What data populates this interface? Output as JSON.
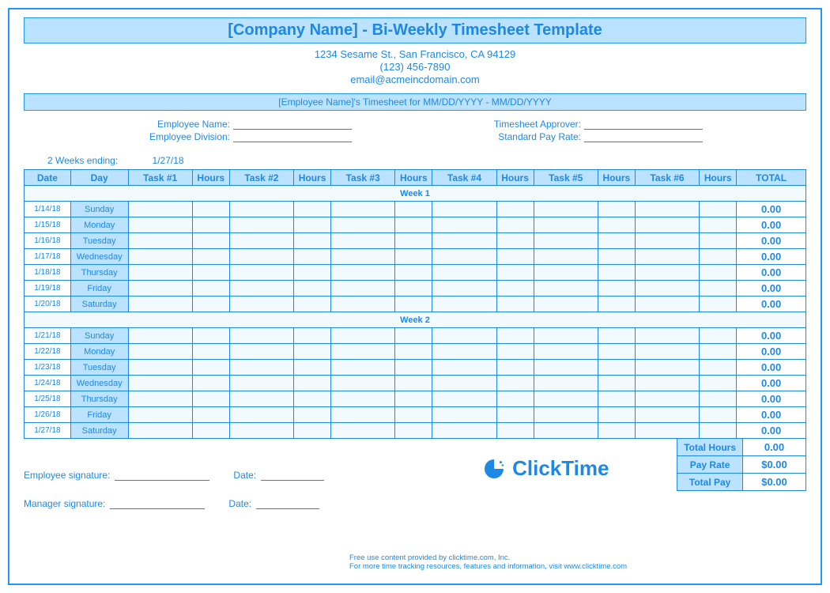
{
  "header": {
    "title": "[Company Name] - Bi-Weekly Timesheet Template",
    "address1": "1234 Sesame St., San Francisco, CA 94129",
    "phone": "(123) 456-7890",
    "email": "email@acmeincdomain.com"
  },
  "employee_bar": "[Employee Name]'s Timesheet for MM/DD/YYYY - MM/DD/YYYY",
  "info": {
    "name_label": "Employee Name:",
    "division_label": "Employee Division:",
    "approver_label": "Timesheet Approver:",
    "payrate_label": "Standard Pay Rate:"
  },
  "ending": {
    "label": "2 Weeks ending:",
    "value": "1/27/18"
  },
  "columns": {
    "date": "Date",
    "day": "Day",
    "t1": "Task #1",
    "h": "Hours",
    "t2": "Task #2",
    "t3": "Task #3",
    "t4": "Task #4",
    "t5": "Task #5",
    "t6": "Task #6",
    "total": "TOTAL"
  },
  "week1_label": "Week 1",
  "week2_label": "Week 2",
  "rows1": [
    {
      "date": "1/14/18",
      "day": "Sunday",
      "total": "0.00"
    },
    {
      "date": "1/15/18",
      "day": "Monday",
      "total": "0.00"
    },
    {
      "date": "1/16/18",
      "day": "Tuesday",
      "total": "0.00"
    },
    {
      "date": "1/17/18",
      "day": "Wednesday",
      "total": "0.00"
    },
    {
      "date": "1/18/18",
      "day": "Thursday",
      "total": "0.00"
    },
    {
      "date": "1/19/18",
      "day": "Friday",
      "total": "0.00"
    },
    {
      "date": "1/20/18",
      "day": "Saturday",
      "total": "0.00"
    }
  ],
  "rows2": [
    {
      "date": "1/21/18",
      "day": "Sunday",
      "total": "0.00"
    },
    {
      "date": "1/22/18",
      "day": "Monday",
      "total": "0.00"
    },
    {
      "date": "1/23/18",
      "day": "Tuesday",
      "total": "0.00"
    },
    {
      "date": "1/24/18",
      "day": "Wednesday",
      "total": "0.00"
    },
    {
      "date": "1/25/18",
      "day": "Thursday",
      "total": "0.00"
    },
    {
      "date": "1/26/18",
      "day": "Friday",
      "total": "0.00"
    },
    {
      "date": "1/27/18",
      "day": "Saturday",
      "total": "0.00"
    }
  ],
  "summary": {
    "total_hours_label": "Total Hours",
    "total_hours": "0.00",
    "pay_rate_label": "Pay Rate",
    "pay_rate": "$0.00",
    "total_pay_label": "Total Pay",
    "total_pay": "$0.00"
  },
  "signatures": {
    "emp": "Employee signature:",
    "date": "Date:",
    "mgr": "Manager signature:"
  },
  "logo_text": "ClickTime",
  "footer1": "Free use content provided by clicktime.com, Inc.",
  "footer2": "For more time tracking resources, features and information, visit www.clicktime.com"
}
